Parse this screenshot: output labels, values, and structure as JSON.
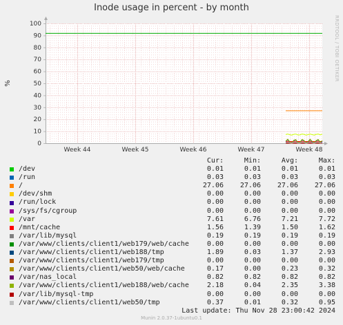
{
  "chart_data": {
    "type": "line",
    "title": "Inode usage in percent - by month",
    "ylabel": "%",
    "ylim": [
      0,
      100
    ],
    "yticks": [
      0,
      10,
      20,
      30,
      40,
      50,
      60,
      70,
      80,
      90,
      100
    ],
    "xticks": [
      "Week 44",
      "Week 45",
      "Week 46",
      "Week 47",
      "Week 48"
    ],
    "grid": true,
    "side_label": "RRDTOOL / TOBI OETIKER",
    "columns": [
      "Cur:",
      "Min:",
      "Avg:",
      "Max:"
    ],
    "series": [
      {
        "name": "/dev",
        "color": "#00cc00",
        "cur": "0.01",
        "min": "0.01",
        "avg": "0.01",
        "max": "0.01"
      },
      {
        "name": "/run",
        "color": "#0066b3",
        "cur": "0.03",
        "min": "0.03",
        "avg": "0.03",
        "max": "0.03"
      },
      {
        "name": "/",
        "color": "#ff8000",
        "cur": "27.06",
        "min": "27.06",
        "avg": "27.06",
        "max": "27.06"
      },
      {
        "name": "/dev/shm",
        "color": "#ffcc00",
        "cur": "0.00",
        "min": "0.00",
        "avg": "0.00",
        "max": "0.00"
      },
      {
        "name": "/run/lock",
        "color": "#330099",
        "cur": "0.00",
        "min": "0.00",
        "avg": "0.00",
        "max": "0.00"
      },
      {
        "name": "/sys/fs/cgroup",
        "color": "#990099",
        "cur": "0.00",
        "min": "0.00",
        "avg": "0.00",
        "max": "0.00"
      },
      {
        "name": "/var",
        "color": "#ccff00",
        "cur": "7.61",
        "min": "6.76",
        "avg": "7.21",
        "max": "7.72"
      },
      {
        "name": "/mnt/cache",
        "color": "#ff0000",
        "cur": "1.56",
        "min": "1.39",
        "avg": "1.50",
        "max": "1.62"
      },
      {
        "name": "/var/lib/mysql",
        "color": "#808080",
        "cur": "0.19",
        "min": "0.19",
        "avg": "0.19",
        "max": "0.19"
      },
      {
        "name": "/var/www/clients/client1/web179/web/cache",
        "color": "#008f00",
        "cur": "0.00",
        "min": "0.00",
        "avg": "0.00",
        "max": "0.00"
      },
      {
        "name": "/var/www/clients/client1/web188/tmp",
        "color": "#00487d",
        "cur": "1.89",
        "min": "0.03",
        "avg": "1.37",
        "max": "2.93"
      },
      {
        "name": "/var/www/clients/client1/web179/tmp",
        "color": "#b35a00",
        "cur": "0.00",
        "min": "0.00",
        "avg": "0.00",
        "max": "0.00"
      },
      {
        "name": "/var/www/clients/client1/web50/web/cache",
        "color": "#b38f00",
        "cur": "0.17",
        "min": "0.00",
        "avg": "0.23",
        "max": "0.32"
      },
      {
        "name": "/var/nas_local",
        "color": "#6b006b",
        "cur": "0.82",
        "min": "0.82",
        "avg": "0.82",
        "max": "0.82"
      },
      {
        "name": "/var/www/clients/client1/web188/web/cache",
        "color": "#8fb300",
        "cur": "2.18",
        "min": "0.04",
        "avg": "2.35",
        "max": "3.38"
      },
      {
        "name": "/var/lib/mysql-tmp",
        "color": "#b30000",
        "cur": "0.00",
        "min": "0.00",
        "avg": "0.00",
        "max": "0.00"
      },
      {
        "name": "/var/www/clients/client1/web50/tmp",
        "color": "#bebebe",
        "cur": "0.37",
        "min": "0.01",
        "avg": "0.32",
        "max": "0.95"
      }
    ],
    "reference_line": {
      "value": 92,
      "color": "#00aa00"
    },
    "last_update": "Last update: Thu Nov 28 23:00:42 2024"
  },
  "footer": "Munin 2.0.37-1ubuntu0.1"
}
